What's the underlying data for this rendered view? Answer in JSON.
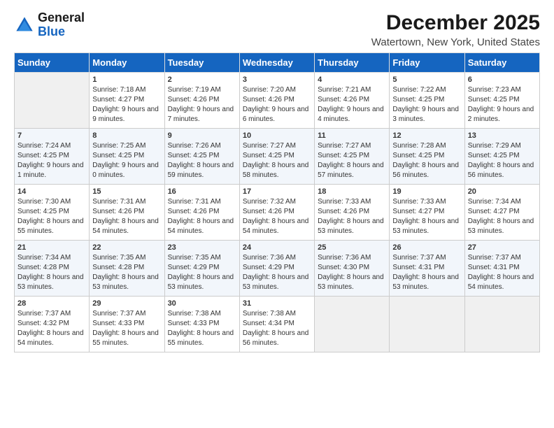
{
  "header": {
    "logo_line1": "General",
    "logo_line2": "Blue",
    "month": "December 2025",
    "location": "Watertown, New York, United States"
  },
  "days_of_week": [
    "Sunday",
    "Monday",
    "Tuesday",
    "Wednesday",
    "Thursday",
    "Friday",
    "Saturday"
  ],
  "weeks": [
    [
      {
        "day": "",
        "empty": true
      },
      {
        "day": "1",
        "sunrise": "7:18 AM",
        "sunset": "4:27 PM",
        "daylight": "9 hours and 9 minutes."
      },
      {
        "day": "2",
        "sunrise": "7:19 AM",
        "sunset": "4:26 PM",
        "daylight": "9 hours and 7 minutes."
      },
      {
        "day": "3",
        "sunrise": "7:20 AM",
        "sunset": "4:26 PM",
        "daylight": "9 hours and 6 minutes."
      },
      {
        "day": "4",
        "sunrise": "7:21 AM",
        "sunset": "4:26 PM",
        "daylight": "9 hours and 4 minutes."
      },
      {
        "day": "5",
        "sunrise": "7:22 AM",
        "sunset": "4:25 PM",
        "daylight": "9 hours and 3 minutes."
      },
      {
        "day": "6",
        "sunrise": "7:23 AM",
        "sunset": "4:25 PM",
        "daylight": "9 hours and 2 minutes."
      }
    ],
    [
      {
        "day": "7",
        "sunrise": "7:24 AM",
        "sunset": "4:25 PM",
        "daylight": "9 hours and 1 minute."
      },
      {
        "day": "8",
        "sunrise": "7:25 AM",
        "sunset": "4:25 PM",
        "daylight": "9 hours and 0 minutes."
      },
      {
        "day": "9",
        "sunrise": "7:26 AM",
        "sunset": "4:25 PM",
        "daylight": "8 hours and 59 minutes."
      },
      {
        "day": "10",
        "sunrise": "7:27 AM",
        "sunset": "4:25 PM",
        "daylight": "8 hours and 58 minutes."
      },
      {
        "day": "11",
        "sunrise": "7:27 AM",
        "sunset": "4:25 PM",
        "daylight": "8 hours and 57 minutes."
      },
      {
        "day": "12",
        "sunrise": "7:28 AM",
        "sunset": "4:25 PM",
        "daylight": "8 hours and 56 minutes."
      },
      {
        "day": "13",
        "sunrise": "7:29 AM",
        "sunset": "4:25 PM",
        "daylight": "8 hours and 56 minutes."
      }
    ],
    [
      {
        "day": "14",
        "sunrise": "7:30 AM",
        "sunset": "4:25 PM",
        "daylight": "8 hours and 55 minutes."
      },
      {
        "day": "15",
        "sunrise": "7:31 AM",
        "sunset": "4:26 PM",
        "daylight": "8 hours and 54 minutes."
      },
      {
        "day": "16",
        "sunrise": "7:31 AM",
        "sunset": "4:26 PM",
        "daylight": "8 hours and 54 minutes."
      },
      {
        "day": "17",
        "sunrise": "7:32 AM",
        "sunset": "4:26 PM",
        "daylight": "8 hours and 54 minutes."
      },
      {
        "day": "18",
        "sunrise": "7:33 AM",
        "sunset": "4:26 PM",
        "daylight": "8 hours and 53 minutes."
      },
      {
        "day": "19",
        "sunrise": "7:33 AM",
        "sunset": "4:27 PM",
        "daylight": "8 hours and 53 minutes."
      },
      {
        "day": "20",
        "sunrise": "7:34 AM",
        "sunset": "4:27 PM",
        "daylight": "8 hours and 53 minutes."
      }
    ],
    [
      {
        "day": "21",
        "sunrise": "7:34 AM",
        "sunset": "4:28 PM",
        "daylight": "8 hours and 53 minutes."
      },
      {
        "day": "22",
        "sunrise": "7:35 AM",
        "sunset": "4:28 PM",
        "daylight": "8 hours and 53 minutes."
      },
      {
        "day": "23",
        "sunrise": "7:35 AM",
        "sunset": "4:29 PM",
        "daylight": "8 hours and 53 minutes."
      },
      {
        "day": "24",
        "sunrise": "7:36 AM",
        "sunset": "4:29 PM",
        "daylight": "8 hours and 53 minutes."
      },
      {
        "day": "25",
        "sunrise": "7:36 AM",
        "sunset": "4:30 PM",
        "daylight": "8 hours and 53 minutes."
      },
      {
        "day": "26",
        "sunrise": "7:37 AM",
        "sunset": "4:31 PM",
        "daylight": "8 hours and 53 minutes."
      },
      {
        "day": "27",
        "sunrise": "7:37 AM",
        "sunset": "4:31 PM",
        "daylight": "8 hours and 54 minutes."
      }
    ],
    [
      {
        "day": "28",
        "sunrise": "7:37 AM",
        "sunset": "4:32 PM",
        "daylight": "8 hours and 54 minutes."
      },
      {
        "day": "29",
        "sunrise": "7:37 AM",
        "sunset": "4:33 PM",
        "daylight": "8 hours and 55 minutes."
      },
      {
        "day": "30",
        "sunrise": "7:38 AM",
        "sunset": "4:33 PM",
        "daylight": "8 hours and 55 minutes."
      },
      {
        "day": "31",
        "sunrise": "7:38 AM",
        "sunset": "4:34 PM",
        "daylight": "8 hours and 56 minutes."
      },
      {
        "day": "",
        "empty": true
      },
      {
        "day": "",
        "empty": true
      },
      {
        "day": "",
        "empty": true
      }
    ]
  ]
}
